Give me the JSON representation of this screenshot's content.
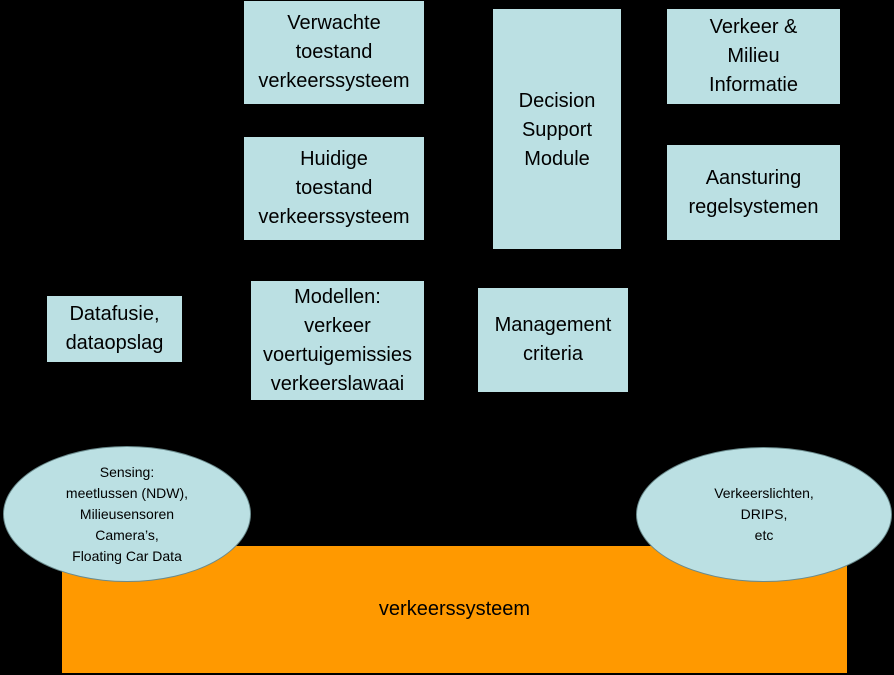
{
  "diagram": {
    "boxes": {
      "expected_state": [
        "Verwachte",
        "toestand",
        "verkeerssysteem"
      ],
      "current_state": [
        "Huidige",
        "toestand",
        "verkeerssysteem"
      ],
      "decision_support": [
        "Decision",
        "Support",
        "Module"
      ],
      "traffic_env_info": [
        "Verkeer &",
        "Milieu",
        "Informatie"
      ],
      "control_systems": [
        "Aansturing",
        "regelsystemen"
      ],
      "data_fusion": [
        "Datafusie,",
        "dataopslag"
      ],
      "models": [
        "Modellen:",
        "verkeer",
        "voertuigemissies",
        "verkeerslawaai"
      ],
      "management_criteria": [
        "Management",
        "criteria"
      ]
    },
    "ellipses": {
      "sensing": [
        "Sensing:",
        "meetlussen (NDW),",
        "Milieusensoren",
        "Camera’s,",
        "Floating Car Data"
      ],
      "actuators": [
        "Verkeerslichten,",
        "DRIPS,",
        "etc"
      ]
    },
    "base": {
      "label": "verkeerssysteem"
    },
    "colors": {
      "box": "#BBE0E3",
      "base": "#FF9900",
      "background": "#000000"
    }
  }
}
